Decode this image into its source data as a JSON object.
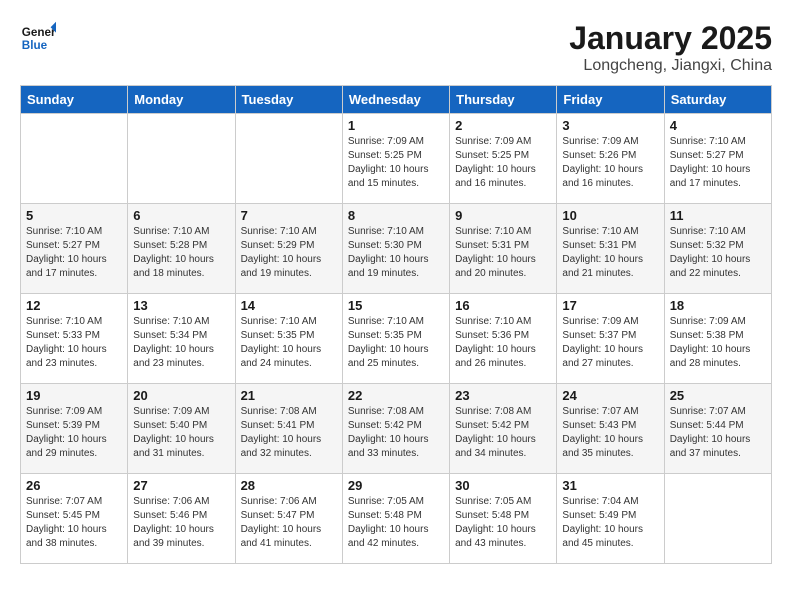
{
  "header": {
    "logo_line1": "General",
    "logo_line2": "Blue",
    "title": "January 2025",
    "subtitle": "Longcheng, Jiangxi, China"
  },
  "days_of_week": [
    "Sunday",
    "Monday",
    "Tuesday",
    "Wednesday",
    "Thursday",
    "Friday",
    "Saturday"
  ],
  "weeks": [
    [
      {
        "day": "",
        "info": ""
      },
      {
        "day": "",
        "info": ""
      },
      {
        "day": "",
        "info": ""
      },
      {
        "day": "1",
        "info": "Sunrise: 7:09 AM\nSunset: 5:25 PM\nDaylight: 10 hours\nand 15 minutes."
      },
      {
        "day": "2",
        "info": "Sunrise: 7:09 AM\nSunset: 5:25 PM\nDaylight: 10 hours\nand 16 minutes."
      },
      {
        "day": "3",
        "info": "Sunrise: 7:09 AM\nSunset: 5:26 PM\nDaylight: 10 hours\nand 16 minutes."
      },
      {
        "day": "4",
        "info": "Sunrise: 7:10 AM\nSunset: 5:27 PM\nDaylight: 10 hours\nand 17 minutes."
      }
    ],
    [
      {
        "day": "5",
        "info": "Sunrise: 7:10 AM\nSunset: 5:27 PM\nDaylight: 10 hours\nand 17 minutes."
      },
      {
        "day": "6",
        "info": "Sunrise: 7:10 AM\nSunset: 5:28 PM\nDaylight: 10 hours\nand 18 minutes."
      },
      {
        "day": "7",
        "info": "Sunrise: 7:10 AM\nSunset: 5:29 PM\nDaylight: 10 hours\nand 19 minutes."
      },
      {
        "day": "8",
        "info": "Sunrise: 7:10 AM\nSunset: 5:30 PM\nDaylight: 10 hours\nand 19 minutes."
      },
      {
        "day": "9",
        "info": "Sunrise: 7:10 AM\nSunset: 5:31 PM\nDaylight: 10 hours\nand 20 minutes."
      },
      {
        "day": "10",
        "info": "Sunrise: 7:10 AM\nSunset: 5:31 PM\nDaylight: 10 hours\nand 21 minutes."
      },
      {
        "day": "11",
        "info": "Sunrise: 7:10 AM\nSunset: 5:32 PM\nDaylight: 10 hours\nand 22 minutes."
      }
    ],
    [
      {
        "day": "12",
        "info": "Sunrise: 7:10 AM\nSunset: 5:33 PM\nDaylight: 10 hours\nand 23 minutes."
      },
      {
        "day": "13",
        "info": "Sunrise: 7:10 AM\nSunset: 5:34 PM\nDaylight: 10 hours\nand 23 minutes."
      },
      {
        "day": "14",
        "info": "Sunrise: 7:10 AM\nSunset: 5:35 PM\nDaylight: 10 hours\nand 24 minutes."
      },
      {
        "day": "15",
        "info": "Sunrise: 7:10 AM\nSunset: 5:35 PM\nDaylight: 10 hours\nand 25 minutes."
      },
      {
        "day": "16",
        "info": "Sunrise: 7:10 AM\nSunset: 5:36 PM\nDaylight: 10 hours\nand 26 minutes."
      },
      {
        "day": "17",
        "info": "Sunrise: 7:09 AM\nSunset: 5:37 PM\nDaylight: 10 hours\nand 27 minutes."
      },
      {
        "day": "18",
        "info": "Sunrise: 7:09 AM\nSunset: 5:38 PM\nDaylight: 10 hours\nand 28 minutes."
      }
    ],
    [
      {
        "day": "19",
        "info": "Sunrise: 7:09 AM\nSunset: 5:39 PM\nDaylight: 10 hours\nand 29 minutes."
      },
      {
        "day": "20",
        "info": "Sunrise: 7:09 AM\nSunset: 5:40 PM\nDaylight: 10 hours\nand 31 minutes."
      },
      {
        "day": "21",
        "info": "Sunrise: 7:08 AM\nSunset: 5:41 PM\nDaylight: 10 hours\nand 32 minutes."
      },
      {
        "day": "22",
        "info": "Sunrise: 7:08 AM\nSunset: 5:42 PM\nDaylight: 10 hours\nand 33 minutes."
      },
      {
        "day": "23",
        "info": "Sunrise: 7:08 AM\nSunset: 5:42 PM\nDaylight: 10 hours\nand 34 minutes."
      },
      {
        "day": "24",
        "info": "Sunrise: 7:07 AM\nSunset: 5:43 PM\nDaylight: 10 hours\nand 35 minutes."
      },
      {
        "day": "25",
        "info": "Sunrise: 7:07 AM\nSunset: 5:44 PM\nDaylight: 10 hours\nand 37 minutes."
      }
    ],
    [
      {
        "day": "26",
        "info": "Sunrise: 7:07 AM\nSunset: 5:45 PM\nDaylight: 10 hours\nand 38 minutes."
      },
      {
        "day": "27",
        "info": "Sunrise: 7:06 AM\nSunset: 5:46 PM\nDaylight: 10 hours\nand 39 minutes."
      },
      {
        "day": "28",
        "info": "Sunrise: 7:06 AM\nSunset: 5:47 PM\nDaylight: 10 hours\nand 41 minutes."
      },
      {
        "day": "29",
        "info": "Sunrise: 7:05 AM\nSunset: 5:48 PM\nDaylight: 10 hours\nand 42 minutes."
      },
      {
        "day": "30",
        "info": "Sunrise: 7:05 AM\nSunset: 5:48 PM\nDaylight: 10 hours\nand 43 minutes."
      },
      {
        "day": "31",
        "info": "Sunrise: 7:04 AM\nSunset: 5:49 PM\nDaylight: 10 hours\nand 45 minutes."
      },
      {
        "day": "",
        "info": ""
      }
    ]
  ]
}
